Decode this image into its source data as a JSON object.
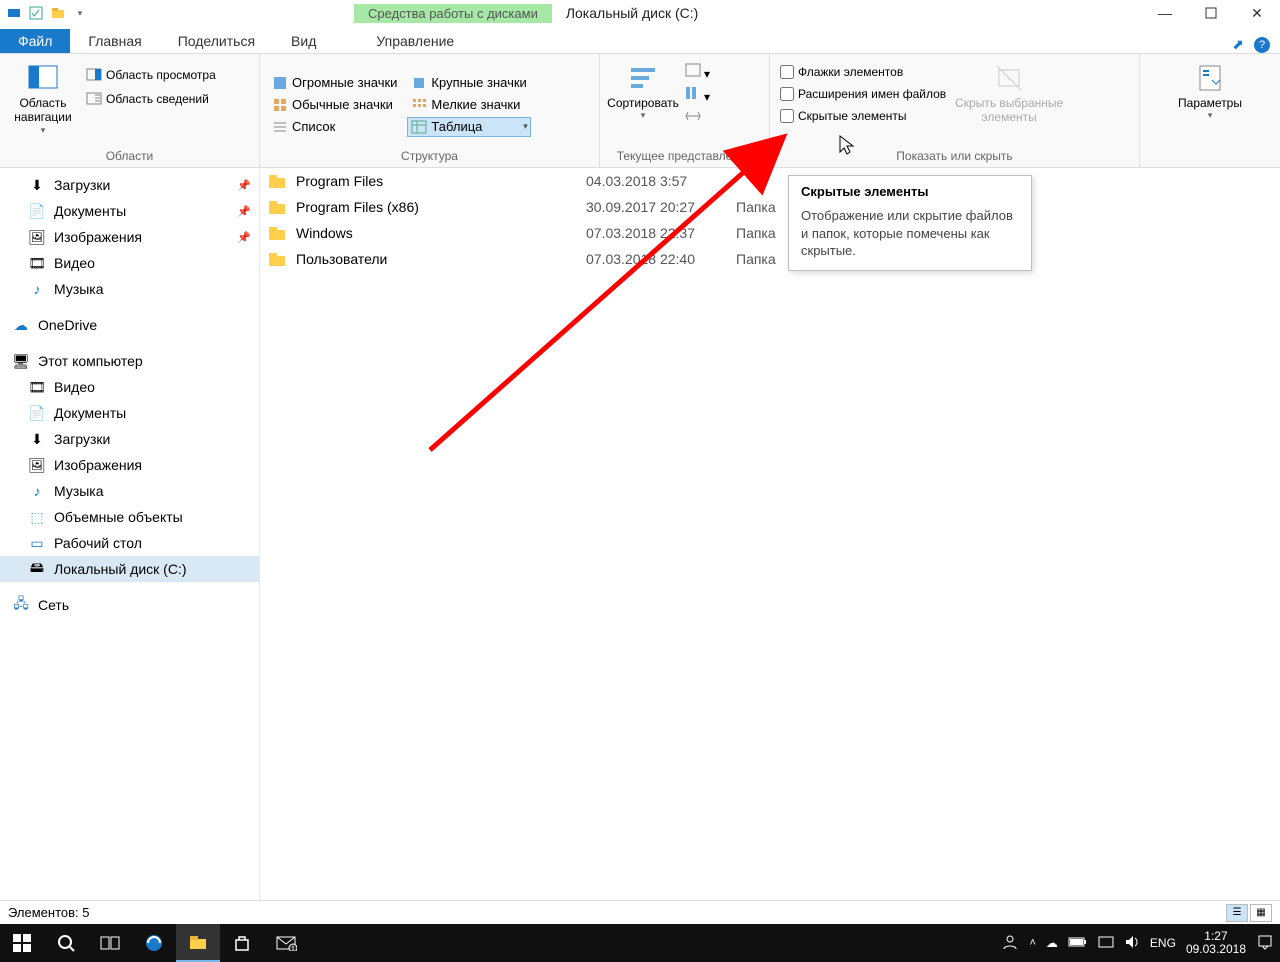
{
  "titlebar": {
    "context_label": "Средства работы с дисками",
    "title": "Локальный диск (C:)"
  },
  "tabs": {
    "file": "Файл",
    "home": "Главная",
    "share": "Поделиться",
    "view": "Вид",
    "manage": "Управление"
  },
  "ribbon": {
    "panes": {
      "nav_pane": "Область навигации",
      "preview_pane": "Область просмотра",
      "details_pane": "Область сведений",
      "group_label": "Области"
    },
    "layout": {
      "huge": "Огромные значки",
      "large": "Крупные значки",
      "medium": "Обычные значки",
      "small": "Мелкие значки",
      "list": "Список",
      "table": "Таблица",
      "group_label": "Структура"
    },
    "current_view": {
      "sort": "Сортировать",
      "group_label": "Текущее представление"
    },
    "show_hide": {
      "item_checkboxes": "Флажки элементов",
      "file_ext": "Расширения имен файлов",
      "hidden_items": "Скрытые элементы",
      "hide_selected": "Скрыть выбранные элементы",
      "group_label": "Показать или скрыть"
    },
    "options": {
      "label": "Параметры"
    }
  },
  "sidebar": {
    "downloads": "Загрузки",
    "documents": "Документы",
    "pictures": "Изображения",
    "videos": "Видео",
    "music": "Музыка",
    "onedrive": "OneDrive",
    "this_pc": "Этот компьютер",
    "pc_videos": "Видео",
    "pc_documents": "Документы",
    "pc_downloads": "Загрузки",
    "pc_pictures": "Изображения",
    "pc_music": "Музыка",
    "pc_3d": "Объемные объекты",
    "pc_desktop": "Рабочий стол",
    "pc_localdisk": "Локальный диск (C:)",
    "network": "Сеть"
  },
  "files": [
    {
      "name": "Program Files",
      "date": "04.03.2018 3:57",
      "type": ""
    },
    {
      "name": "Program Files (x86)",
      "date": "30.09.2017 20:27",
      "type": "Папка"
    },
    {
      "name": "Windows",
      "date": "07.03.2018 22:37",
      "type": "Папка"
    },
    {
      "name": "Пользователи",
      "date": "07.03.2018 22:40",
      "type": "Папка"
    }
  ],
  "tooltip": {
    "title": "Скрытые элементы",
    "body": "Отображение или скрытие файлов и папок, которые помечены как скрытые."
  },
  "statusbar": {
    "count_label": "Элементов: 5"
  },
  "taskbar": {
    "lang": "ENG",
    "time": "1:27",
    "date": "09.03.2018"
  }
}
